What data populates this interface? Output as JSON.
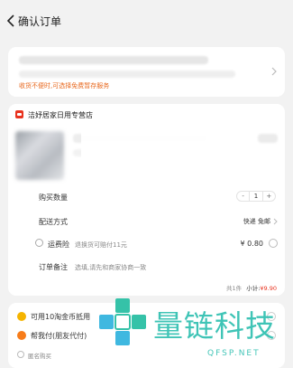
{
  "header": {
    "title": "确认订单"
  },
  "address": {
    "note": "收货不便时,可选择免费暂存服务"
  },
  "store": {
    "name": "洁妤居家日用专营店"
  },
  "order": {
    "quantity_label": "购买数量",
    "quantity_minus": "-",
    "quantity_value": "1",
    "quantity_plus": "+",
    "delivery_label": "配送方式",
    "delivery_value": "快递 免邮",
    "insurance_label": "运费险",
    "insurance_desc": "退换货可赔付11元",
    "insurance_price": "¥ 0.80",
    "remark_label": "订单备注",
    "remark_placeholder": "选填,请先和商家协商一致",
    "summary_count": "共1件",
    "subtotal_label": "小计:",
    "subtotal_value": "¥9.90"
  },
  "payment": {
    "coin_label": "可用10淘金币抵用",
    "friend_label": "帮我付(朋友代付)",
    "anon_label": "匿名购买"
  },
  "watermark": {
    "text": "量链科技",
    "url": "QFSP.NET"
  },
  "colors": {
    "accent": "#e8671c",
    "price": "#e8331f",
    "watermark": "#2fbfb0"
  }
}
